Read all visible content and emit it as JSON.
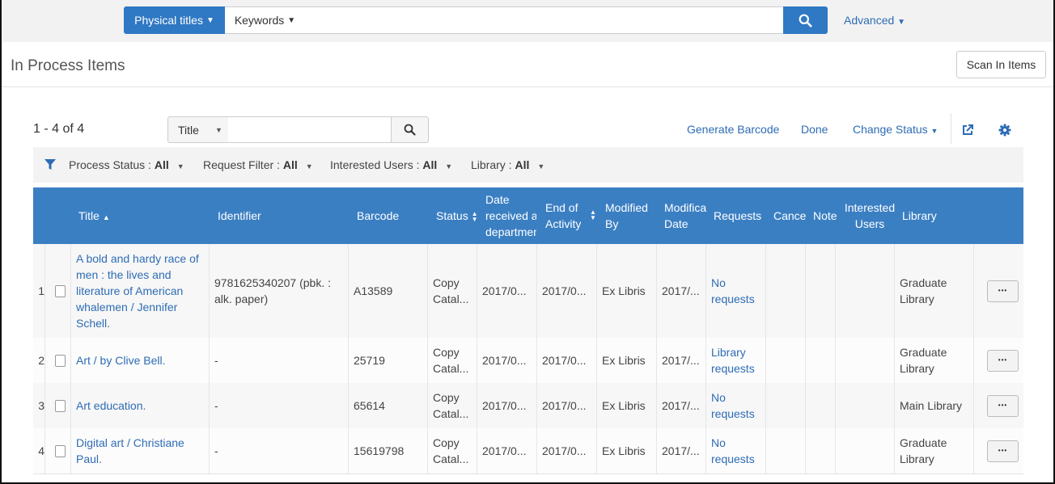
{
  "search": {
    "scope_label": "Physical titles",
    "type_label": "Keywords",
    "query_value": "",
    "advanced_label": "Advanced"
  },
  "page": {
    "title": "In Process Items",
    "scan_button_label": "Scan In Items"
  },
  "toolbar": {
    "count": "1 - 4 of 4",
    "field_select": "Title",
    "field_value": "",
    "generate_barcode": "Generate Barcode",
    "done": "Done",
    "change_status": "Change Status"
  },
  "filters": [
    {
      "label": "Process Status : ",
      "value": "All"
    },
    {
      "label": "Request Filter : ",
      "value": "All"
    },
    {
      "label": "Interested Users : ",
      "value": "All"
    },
    {
      "label": "Library : ",
      "value": "All"
    }
  ],
  "columns": {
    "title": "Title",
    "identifier": "Identifier",
    "barcode": "Barcode",
    "status": "Status",
    "date_received_1": "Date",
    "date_received_2": "received a",
    "date_received_3": "departmen",
    "end_activity_1": "End of",
    "end_activity_2": "Activity",
    "modified_by_1": "Modified",
    "modified_by_2": "By",
    "modification_date_1": "Modifica",
    "modification_date_2": "Date",
    "requests": "Requests",
    "cancel": "Cance",
    "note": "Note",
    "interested_users_1": "Interested",
    "interested_users_2": "Users",
    "library": "Library"
  },
  "rows": [
    {
      "num": "1",
      "title": "A bold and hardy race of men : the lives and literature of American whalemen / Jennifer Schell.",
      "identifier": "9781625340207 (pbk. : alk. paper)",
      "barcode": "A13589",
      "status": "Copy Catal...",
      "date_received": "2017/0...",
      "end_activity": "2017/0...",
      "modified_by": "Ex Libris",
      "modification_date": "2017/...",
      "requests": "No requests",
      "library": "Graduate Library"
    },
    {
      "num": "2",
      "title": "Art / by Clive Bell.",
      "identifier": "-",
      "barcode": "25719",
      "status": "Copy Catal...",
      "date_received": "2017/0...",
      "end_activity": "2017/0...",
      "modified_by": "Ex Libris",
      "modification_date": "2017/...",
      "requests": "Library requests",
      "library": "Graduate Library"
    },
    {
      "num": "3",
      "title": "Art education.",
      "identifier": "-",
      "barcode": "65614",
      "status": "Copy Catal...",
      "date_received": "2017/0...",
      "end_activity": "2017/0...",
      "modified_by": "Ex Libris",
      "modification_date": "2017/...",
      "requests": "No requests",
      "library": "Main Library"
    },
    {
      "num": "4",
      "title": "Digital art / Christiane Paul.",
      "identifier": "-",
      "barcode": "15619798",
      "status": "Copy Catal...",
      "date_received": "2017/0...",
      "end_activity": "2017/0...",
      "modified_by": "Ex Libris",
      "modification_date": "2017/...",
      "requests": "No requests",
      "library": "Graduate Library"
    }
  ],
  "colors": {
    "primary": "#2f78c4",
    "header": "#3b7fc3",
    "link": "#2e6cb5"
  },
  "icons": {
    "search": "magnifier-icon",
    "export": "external-link-icon",
    "settings": "gear-icon",
    "filter": "funnel-icon",
    "more": "ellipsis-icon"
  }
}
